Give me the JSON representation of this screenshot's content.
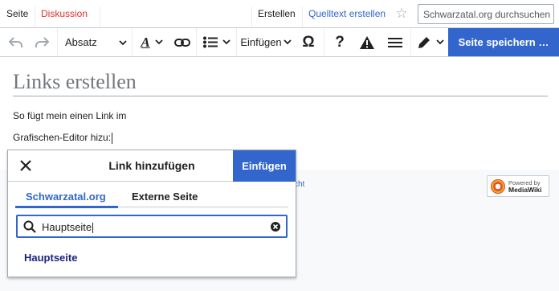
{
  "tabs": {
    "left": [
      {
        "label": "Seite",
        "color": "#202122"
      },
      {
        "label": "Diskussion",
        "color": "#dd3333"
      }
    ],
    "right": [
      {
        "label": "Erstellen"
      },
      {
        "label": "Quelltext erstellen"
      }
    ]
  },
  "search": {
    "placeholder": "Schwarzatal.org durchsuchen"
  },
  "toolbar": {
    "undo_icon": "undo-icon",
    "redo_icon": "redo-icon",
    "paragraph_label": "Absatz",
    "text_style_icon": "text-style-icon",
    "link_icon": "link-icon",
    "list_icon": "list-icon",
    "insert_label": "Einfügen",
    "special_chars_icon": "omega-icon",
    "help_icon": "help-icon",
    "notices_icon": "warning-icon",
    "page_options_icon": "menu-icon",
    "edit_mode_icon": "pencil-icon",
    "save_label": "Seite speichern …"
  },
  "content": {
    "title": "Links erstellen",
    "line1": "So fügt mein einen Link im",
    "line2": "Grafischen-Editor hizu:"
  },
  "footer": {
    "partial_link": "cht",
    "badge_top": "Powered by",
    "badge_bottom": "MediaWiki"
  },
  "dialog": {
    "title": "Link hinzufügen",
    "insert_label": "Einfügen",
    "tab_internal": "Schwarzatal.org",
    "tab_external": "Externe Seite",
    "search_value": "Hauptseite",
    "result": "Hauptseite"
  },
  "colors": {
    "accent": "#3366cc",
    "red_link": "#dd3333"
  }
}
